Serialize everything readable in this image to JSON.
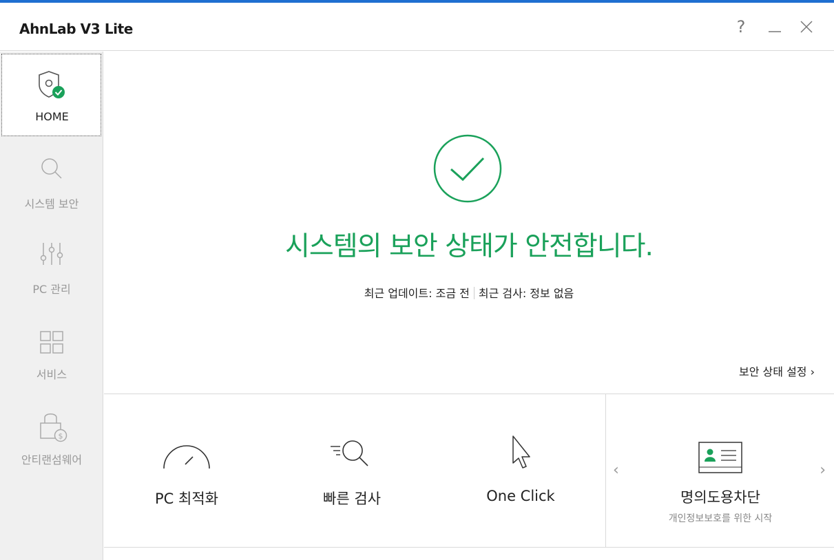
{
  "app": {
    "title": "AhnLab V3 Lite",
    "accent": "#1aa15a",
    "topbar": "#1f6fd1"
  },
  "window_controls": {
    "help": "?",
    "minimize_icon": "minimize-icon",
    "close_icon": "close-icon"
  },
  "sidebar": {
    "items": [
      {
        "label": "HOME",
        "icon": "shield-check-icon",
        "active": true
      },
      {
        "label": "시스템 보안",
        "icon": "search-icon"
      },
      {
        "label": "PC 관리",
        "icon": "sliders-icon"
      },
      {
        "label": "서비스",
        "icon": "grid-icon"
      },
      {
        "label": "안티랜섬웨어",
        "icon": "lock-icon"
      }
    ]
  },
  "main": {
    "status_title": "시스템의 보안 상태가 안전합니다.",
    "last_update": "최근 업데이트: 조금 전",
    "last_scan": "최근 검사: 정보 없음",
    "settings_link": "보안 상태 설정 ›"
  },
  "actions": [
    {
      "label": "PC 최적화",
      "icon": "speedometer-icon"
    },
    {
      "label": "빠른 검사",
      "icon": "quick-scan-icon"
    },
    {
      "label": "One Click",
      "icon": "cursor-icon"
    }
  ],
  "promo": {
    "title": "명의도용차단",
    "subtitle": "개인정보보호를 위한 시작",
    "prev": "‹",
    "next": "›"
  }
}
